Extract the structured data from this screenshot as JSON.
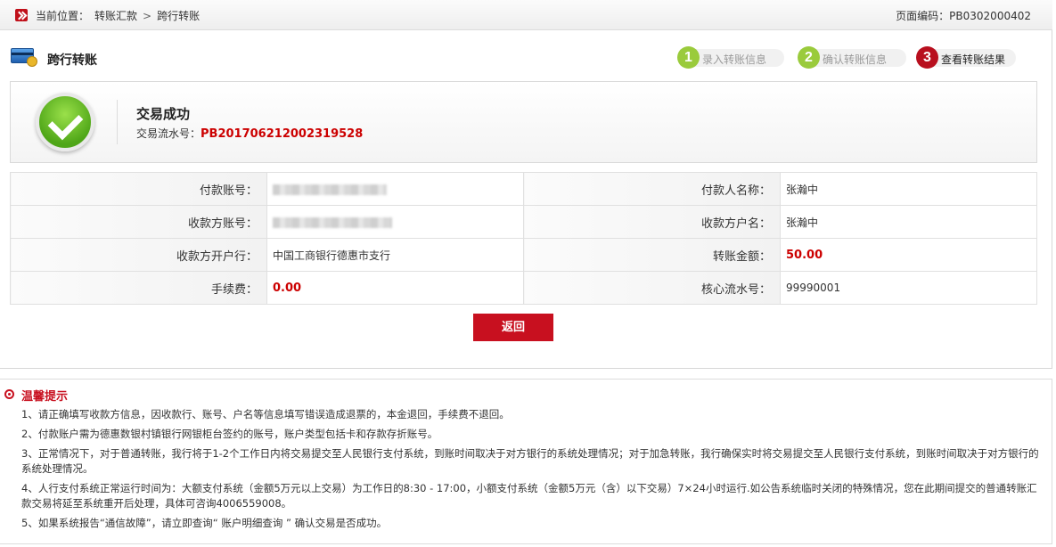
{
  "breadcrumb": {
    "prefix": "当前位置：",
    "level1": "转账汇款",
    "separator": ">",
    "level2": "跨行转账"
  },
  "page_code": "页面编码：PB0302000402",
  "page_title": "跨行转账",
  "steps": [
    {
      "num": "1",
      "label": "录入转账信息",
      "state": "done"
    },
    {
      "num": "2",
      "label": "确认转账信息",
      "state": "done"
    },
    {
      "num": "3",
      "label": "查看转账结果",
      "state": "active"
    }
  ],
  "result": {
    "title": "交易成功",
    "serial_label": "交易流水号：",
    "serial_value": "PB201706212002319528"
  },
  "details": {
    "payer_account_label": "付款账号：",
    "payer_name_label": "付款人名称：",
    "payer_name": "张瀚中",
    "payee_account_label": "收款方账号：",
    "payee_name_label": "收款方户名：",
    "payee_name": "张瀚中",
    "payee_bank_label": "收款方开户行：",
    "payee_bank": "中国工商银行德惠市支行",
    "amount_label": "转账金额：",
    "amount": "50.00",
    "fee_label": "手续费：",
    "fee": "0.00",
    "core_serial_label": "核心流水号：",
    "core_serial": "99990001"
  },
  "back_button": "返回",
  "tips": {
    "title": "温馨提示",
    "items": [
      "1、请正确填写收款方信息，因收款行、账号、户名等信息填写错误造成退票的，本金退回，手续费不退回。",
      "2、付款账户需为德惠数银村镇银行网银柜台签约的账号，账户类型包括卡和存款存折账号。",
      "3、正常情况下，对于普通转账，我行将于1-2个工作日内将交易提交至人民银行支付系统，到账时间取决于对方银行的系统处理情况；对于加急转账，我行确保实时将交易提交至人民银行支付系统，到账时间取决于对方银行的系统处理情况。",
      "4、人行支付系统正常运行时间为：大额支付系统（金额5万元以上交易）为工作日的8:30 - 17:00，小额支付系统（金额5万元（含）以下交易）7×24小时运行.如公告系统临时关闭的特殊情况，您在此期间提交的普通转账汇款交易将延至系统重开后处理，具体可咨询4006559008。",
      "5、如果系统报告“通信故障”，请立即查询“ 账户明细查询 ” 确认交易是否成功。"
    ]
  },
  "colors": {
    "brand_red": "#c8101f",
    "step_done_green": "#9acb3c",
    "value_red": "#cc0000"
  }
}
